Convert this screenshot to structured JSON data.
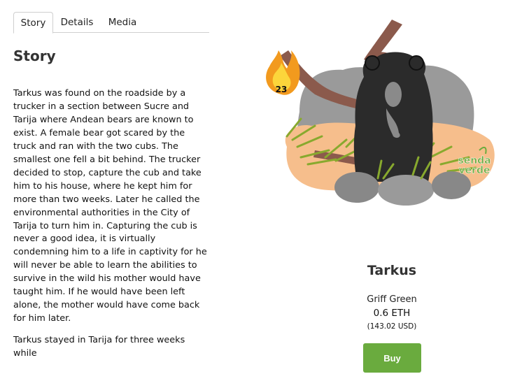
{
  "tabs": [
    {
      "label": "Story"
    },
    {
      "label": "Details"
    },
    {
      "label": "Media"
    }
  ],
  "story": {
    "heading": "Story",
    "paragraphs": [
      "Tarkus was found on the roadside by a trucker in a section between Sucre and Tarija where Andean bears are known to exist. A female bear got scared by the truck and ran with the two cubs. The smallest one fell a bit behind. The trucker decided to stop, capture the cub and take him to his house, where he kept him for more than two weeks. Later he called the environmental authorities in the City of Tarija to turn him in. Capturing the cub is never a good idea, it is virtually condemning him to a life in captivity for he will never be able to learn the abilities to survive in the wild his mother would have taught him. If he would have been left alone, the mother would have come back for him later.",
      "Tarkus stayed in Tarija for three weeks while"
    ]
  },
  "art": {
    "fire_count": "23",
    "logo_line1": "senda",
    "logo_line2": "verde"
  },
  "nft": {
    "name": "Tarkus",
    "owner": "Griff Green",
    "price_eth": "0.6 ETH",
    "price_usd": "(143.02 USD)",
    "buy_label": "Buy"
  },
  "colors": {
    "accent": "#6aab3e",
    "heading": "#333333",
    "tab_border": "#cfcfcf"
  }
}
